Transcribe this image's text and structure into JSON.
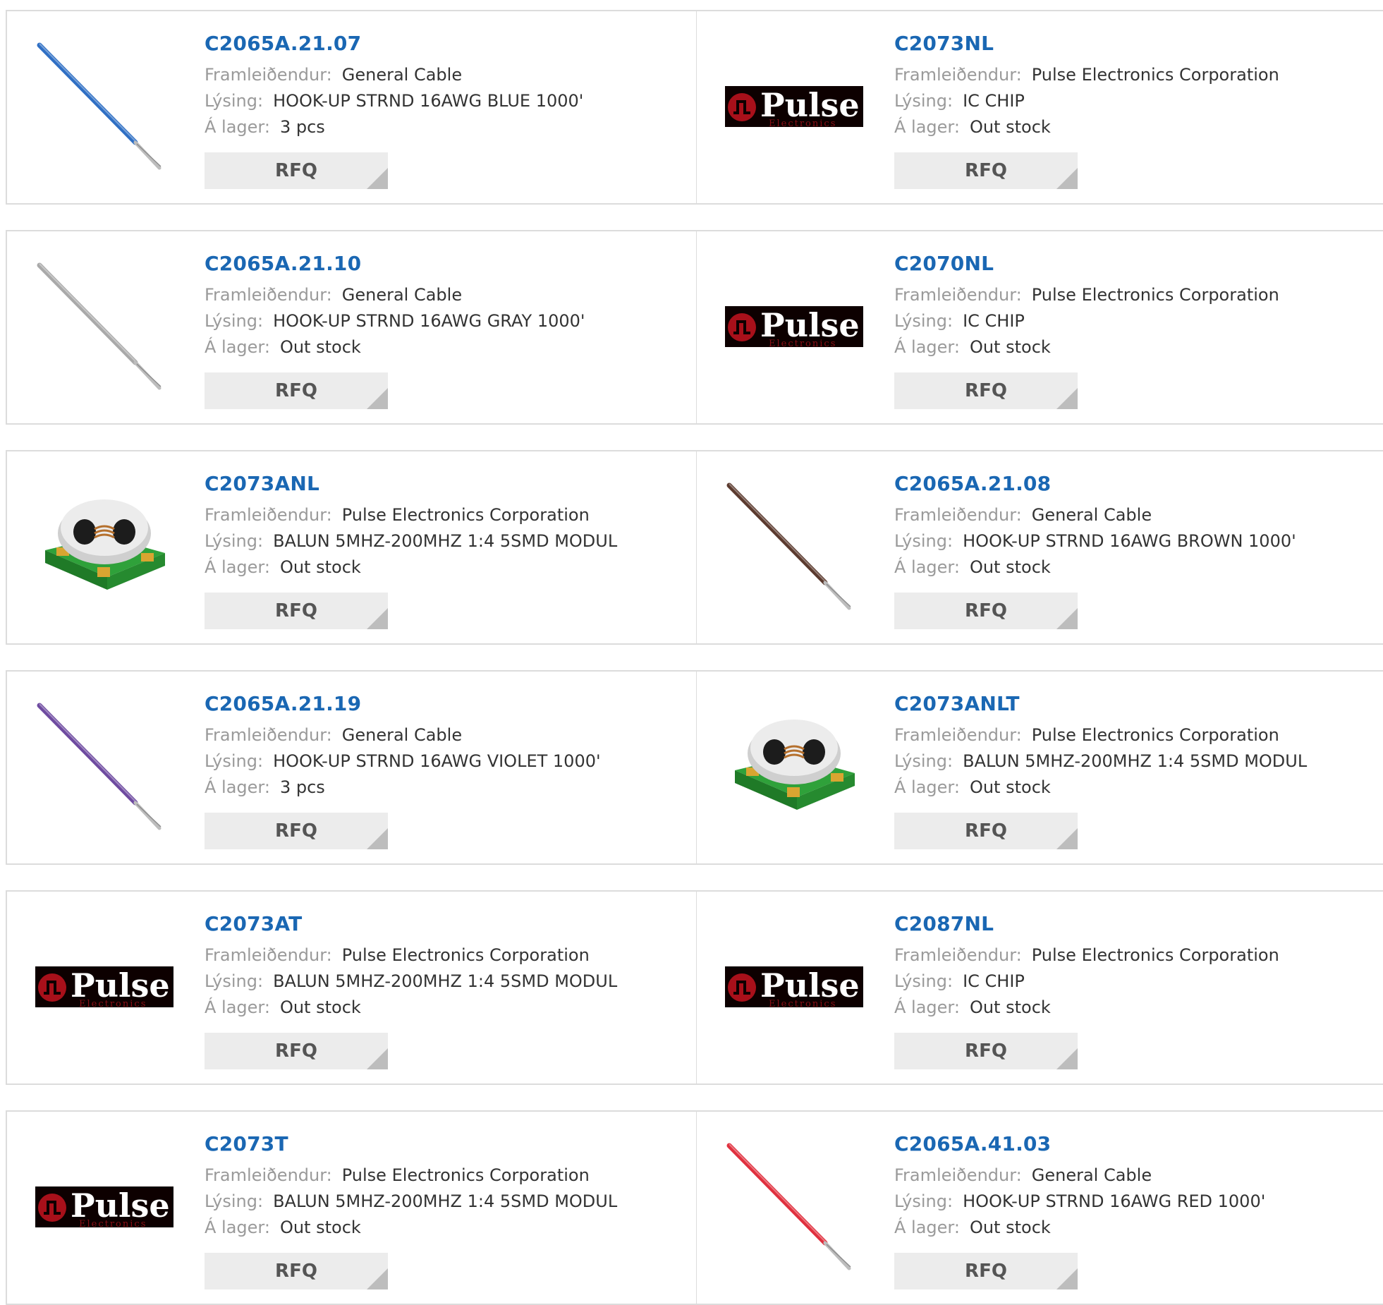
{
  "labels": {
    "manufacturer": "Framleiðendur:",
    "description": "Lýsing:",
    "stock": "Á lager:",
    "rfq": "RFQ"
  },
  "colors": {
    "part_number": "#1a67b3",
    "label": "#9a9a9a",
    "value": "#333333",
    "rfq_bg": "#ececec"
  },
  "products": [
    {
      "part": "C2065A.21.07",
      "manufacturer": "General Cable",
      "description": "HOOK-UP STRND 16AWG BLUE 1000'",
      "stock": "3 pcs",
      "image": "wire-blue"
    },
    {
      "part": "C2073NL",
      "manufacturer": "Pulse Electronics Corporation",
      "description": "IC CHIP",
      "stock": "Out stock",
      "image": "pulse-logo"
    },
    {
      "part": "C2065A.21.10",
      "manufacturer": "General Cable",
      "description": "HOOK-UP STRND 16AWG GRAY 1000'",
      "stock": "Out stock",
      "image": "wire-gray"
    },
    {
      "part": "C2070NL",
      "manufacturer": "Pulse Electronics Corporation",
      "description": "IC CHIP",
      "stock": "Out stock",
      "image": "pulse-logo"
    },
    {
      "part": "C2073ANL",
      "manufacturer": "Pulse Electronics Corporation",
      "description": "BALUN 5MHZ-200MHZ 1:4 5SMD MODUL",
      "stock": "Out stock",
      "image": "balun"
    },
    {
      "part": "C2065A.21.08",
      "manufacturer": "General Cable",
      "description": "HOOK-UP STRND 16AWG BROWN 1000'",
      "stock": "Out stock",
      "image": "wire-brown"
    },
    {
      "part": "C2065A.21.19",
      "manufacturer": "General Cable",
      "description": "HOOK-UP STRND 16AWG VIOLET 1000'",
      "stock": "3 pcs",
      "image": "wire-violet"
    },
    {
      "part": "C2073ANLT",
      "manufacturer": "Pulse Electronics Corporation",
      "description": "BALUN 5MHZ-200MHZ 1:4 5SMD MODUL",
      "stock": "Out stock",
      "image": "balun"
    },
    {
      "part": "C2073AT",
      "manufacturer": "Pulse Electronics Corporation",
      "description": "BALUN 5MHZ-200MHZ 1:4 5SMD MODUL",
      "stock": "Out stock",
      "image": "pulse-logo"
    },
    {
      "part": "C2087NL",
      "manufacturer": "Pulse Electronics Corporation",
      "description": "IC CHIP",
      "stock": "Out stock",
      "image": "pulse-logo"
    },
    {
      "part": "C2073T",
      "manufacturer": "Pulse Electronics Corporation",
      "description": "BALUN 5MHZ-200MHZ 1:4 5SMD MODUL",
      "stock": "Out stock",
      "image": "pulse-logo"
    },
    {
      "part": "C2065A.41.03",
      "manufacturer": "General Cable",
      "description": "HOOK-UP STRND 16AWG RED 1000'",
      "stock": "Out stock",
      "image": "wire-red"
    }
  ],
  "image_colors": {
    "wire-blue": "#2f6fc4",
    "wire-gray": "#a9a9a9",
    "wire-brown": "#5b3a2e",
    "wire-violet": "#6e4aa0",
    "wire-red": "#e0303e"
  },
  "logo_text": {
    "word": "Pulse",
    "sub": "Electronics"
  }
}
